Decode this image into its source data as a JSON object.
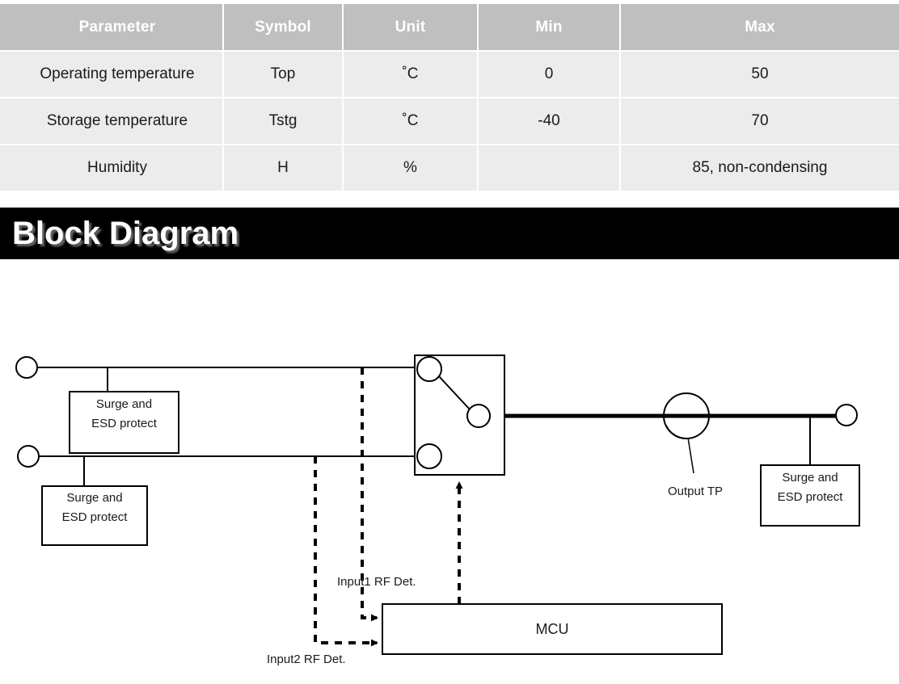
{
  "table": {
    "headers": [
      "Parameter",
      "Symbol",
      "Unit",
      "Min",
      "Max"
    ],
    "rows": [
      {
        "parameter": "Operating temperature",
        "symbol": "Top",
        "unit": "˚C",
        "min": "0",
        "max": "50"
      },
      {
        "parameter": "Storage temperature",
        "symbol": "Tstg",
        "unit": "˚C",
        "min": "-40",
        "max": "70"
      },
      {
        "parameter": "Humidity",
        "symbol": "H",
        "unit": "%",
        "min": "",
        "max": "85, non-condensing"
      }
    ],
    "header_bg": "#bfbfbf",
    "row_bg": "#ececec"
  },
  "banner": {
    "title": "Block Diagram",
    "bg": "#000000",
    "text_color": "#ffffff"
  },
  "diagram": {
    "surge_box_1": {
      "line1": "Surge and",
      "line2": "ESD protect"
    },
    "surge_box_2": {
      "line1": "Surge and",
      "line2": "ESD protect"
    },
    "surge_box_3": {
      "line1": "Surge and",
      "line2": "ESD protect"
    },
    "output_tp_label": "Output  TP",
    "mcu_label": "MCU",
    "input1_label": "Input1 RF Det.",
    "input2_label": "Input2  RF Det.",
    "stroke_color": "#000000"
  }
}
